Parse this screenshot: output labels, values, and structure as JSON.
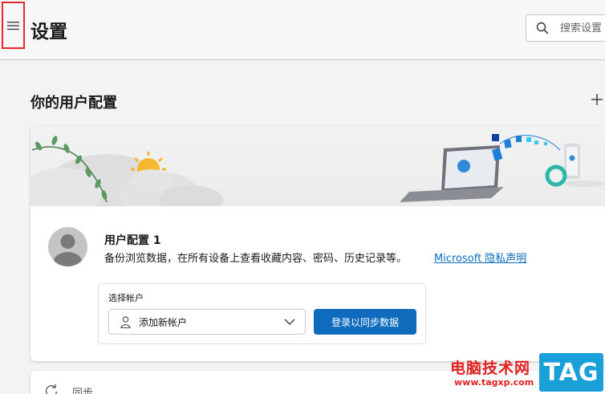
{
  "header": {
    "title": "设置",
    "search_placeholder": "搜索设置"
  },
  "profiles": {
    "section_title": "你的用户配置",
    "profile": {
      "name": "用户配置 1",
      "description": "备份浏览数据，在所有设备上查看收藏内容、密码、历史记录等。",
      "privacy_link": "Microsoft 隐私声明"
    },
    "account": {
      "label": "选择帐户",
      "selected": "添加新帐户",
      "signin_button": "登录以同步数据"
    },
    "sync_label": "同步"
  },
  "watermark": {
    "site_name": "电脑技术网",
    "url": "www.tagxp.com",
    "logo_text": "TAG"
  },
  "colors": {
    "accent": "#0f6cbd",
    "highlight_border": "#e8262c",
    "watermark_red": "#e02020",
    "watermark_blue": "#1aa0d8"
  }
}
